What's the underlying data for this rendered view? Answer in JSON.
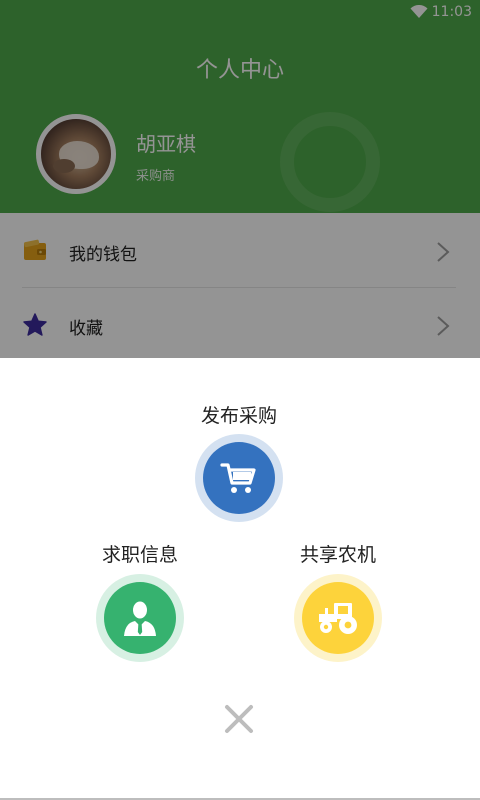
{
  "status_bar": {
    "time": "11:03"
  },
  "header": {
    "title": "个人中心",
    "user": {
      "name": "胡亚棋",
      "role": "采购商"
    }
  },
  "menu": {
    "items": [
      {
        "label": "我的钱包",
        "icon": "wallet-icon"
      },
      {
        "label": "收藏",
        "icon": "star-icon"
      }
    ]
  },
  "actions": {
    "purchase": {
      "label": "发布采购",
      "icon": "shopping-cart-icon",
      "color": "#3472bf"
    },
    "jobs": {
      "label": "求职信息",
      "icon": "person-icon",
      "color": "#36b26f"
    },
    "machine": {
      "label": "共享农机",
      "icon": "tractor-icon",
      "color": "#fdd33b"
    }
  },
  "close": {
    "icon": "close-icon"
  },
  "colors": {
    "header_bg": "#4fa94a",
    "overlay": "rgba(0,0,0,0.42)"
  }
}
